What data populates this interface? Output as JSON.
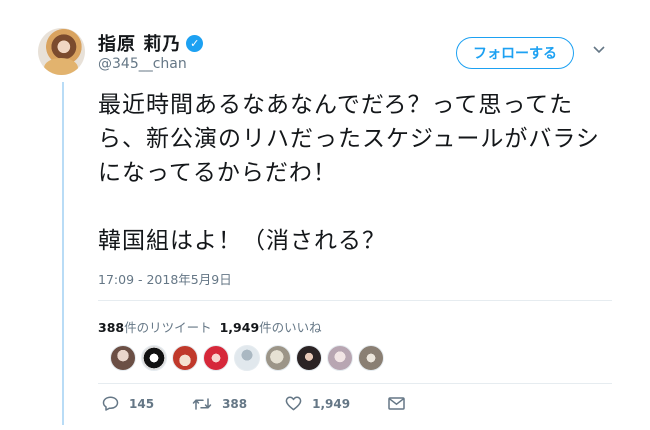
{
  "user": {
    "name": "指原 莉乃",
    "verified_mark": "✓",
    "handle": "@345__chan"
  },
  "header": {
    "follow_label": "フォローする",
    "more_icon": "chevron-down-icon"
  },
  "tweet": {
    "text": "最近時間あるなあなんでだろ？って思ってたら、新公演のリハだったスケジュールがバラシになってるからだわ！\n\n韓国組はよ！（消される？",
    "timestamp": "17:09 - 2018年5月9日"
  },
  "stats": {
    "retweets_count": "388",
    "retweets_label": "件のリツイート",
    "likes_count": "1,949",
    "likes_label": "件のいいね"
  },
  "actions": {
    "reply_count": "145",
    "retweet_count": "388",
    "like_count": "1,949"
  },
  "colors": {
    "accent": "#1da1f2",
    "muted": "#657786",
    "thread_line": "#b9dcf6"
  }
}
